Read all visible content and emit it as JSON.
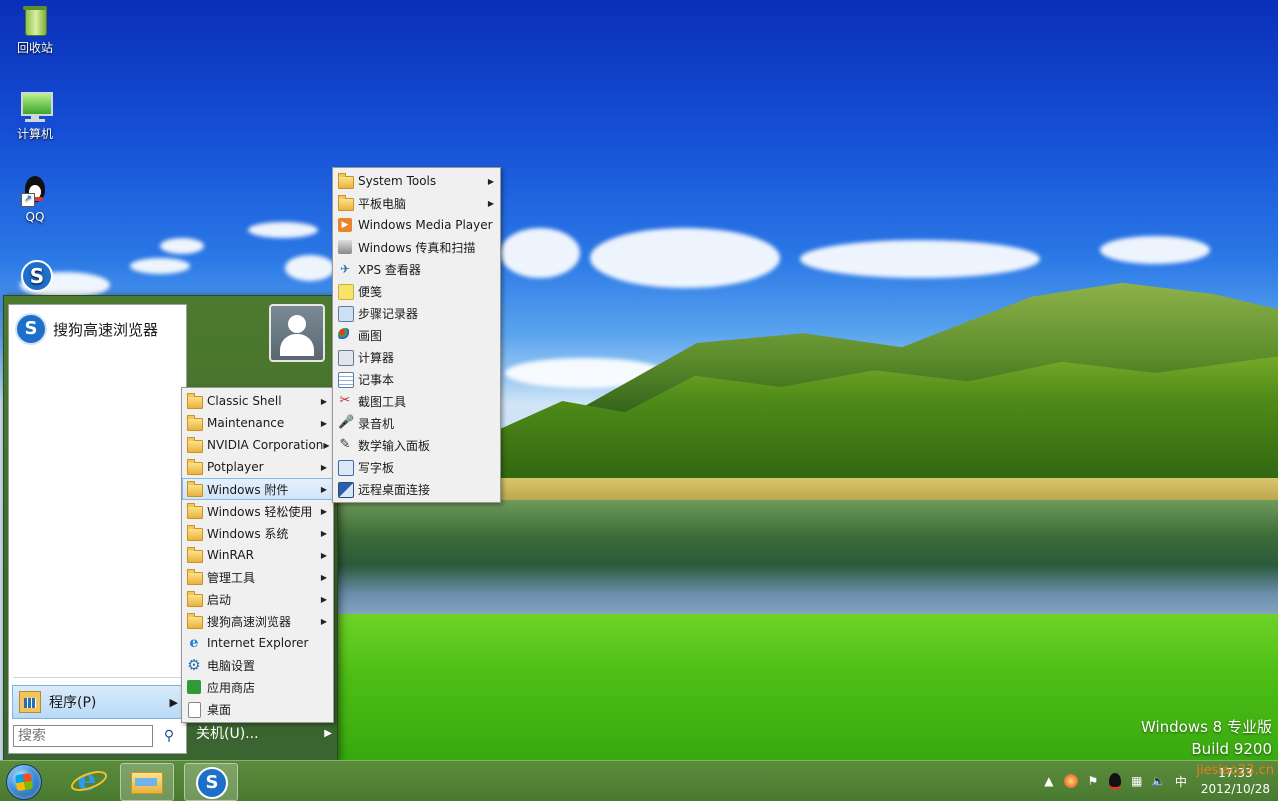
{
  "desktop": {
    "icons": [
      {
        "label": "回收站"
      },
      {
        "label": "计算机"
      },
      {
        "label": "QQ"
      },
      {
        "label": ""
      }
    ],
    "watermark": {
      "line1": "Windows 8 专业版",
      "line2": "Build 9200"
    }
  },
  "start_menu": {
    "pinned_label": "搜狗高速浏览器",
    "programs_label": "程序(P)",
    "search_placeholder": "搜索",
    "shutdown_label": "关机(U)..."
  },
  "programs_menu": {
    "items": [
      {
        "label": "Classic Shell",
        "icon": "folder-icon",
        "submenu": true
      },
      {
        "label": "Maintenance",
        "icon": "folder-icon",
        "submenu": true
      },
      {
        "label": "NVIDIA Corporation",
        "icon": "folder-icon",
        "submenu": true
      },
      {
        "label": "Potplayer",
        "icon": "folder-icon",
        "submenu": true
      },
      {
        "label": "Windows 附件",
        "icon": "folder-icon",
        "submenu": true,
        "selected": true
      },
      {
        "label": "Windows 轻松使用",
        "icon": "folder-icon",
        "submenu": true
      },
      {
        "label": "Windows 系统",
        "icon": "folder-icon",
        "submenu": true
      },
      {
        "label": "WinRAR",
        "icon": "folder-icon",
        "submenu": true
      },
      {
        "label": "管理工具",
        "icon": "folder-icon",
        "submenu": true
      },
      {
        "label": "启动",
        "icon": "folder-icon",
        "submenu": true
      },
      {
        "label": "搜狗高速浏览器",
        "icon": "folder-icon",
        "submenu": true
      },
      {
        "label": "Internet Explorer",
        "icon": "ie-icon",
        "submenu": false
      },
      {
        "label": "电脑设置",
        "icon": "gear-icon",
        "submenu": false
      },
      {
        "label": "应用商店",
        "icon": "store-icon",
        "submenu": false
      },
      {
        "label": "桌面",
        "icon": "desktop-icon",
        "submenu": false
      }
    ]
  },
  "accessories_menu": {
    "items": [
      {
        "label": "System Tools",
        "icon": "folder-icon",
        "submenu": true
      },
      {
        "label": "平板电脑",
        "icon": "folder-icon",
        "submenu": true
      },
      {
        "label": "Windows Media Player",
        "icon": "media-player-icon",
        "submenu": false
      },
      {
        "label": "Windows 传真和扫描",
        "icon": "fax-icon",
        "submenu": false
      },
      {
        "label": "XPS 查看器",
        "icon": "xps-icon",
        "submenu": false
      },
      {
        "label": "便笺",
        "icon": "sticky-notes-icon",
        "submenu": false
      },
      {
        "label": "步骤记录器",
        "icon": "steps-recorder-icon",
        "submenu": false
      },
      {
        "label": "画图",
        "icon": "paint-icon",
        "submenu": false
      },
      {
        "label": "计算器",
        "icon": "calculator-icon",
        "submenu": false
      },
      {
        "label": "记事本",
        "icon": "notepad-icon",
        "submenu": false
      },
      {
        "label": "截图工具",
        "icon": "snipping-tool-icon",
        "submenu": false
      },
      {
        "label": "录音机",
        "icon": "sound-recorder-icon",
        "submenu": false
      },
      {
        "label": "数学输入面板",
        "icon": "math-input-icon",
        "submenu": false
      },
      {
        "label": "写字板",
        "icon": "wordpad-icon",
        "submenu": false
      },
      {
        "label": "远程桌面连接",
        "icon": "remote-desktop-icon",
        "submenu": false
      }
    ]
  },
  "taskbar": {
    "clock_time": "17:33",
    "clock_date": "2012/10/28",
    "tray_ime": "中",
    "tray_watermark": "jiesiao23.cn"
  }
}
